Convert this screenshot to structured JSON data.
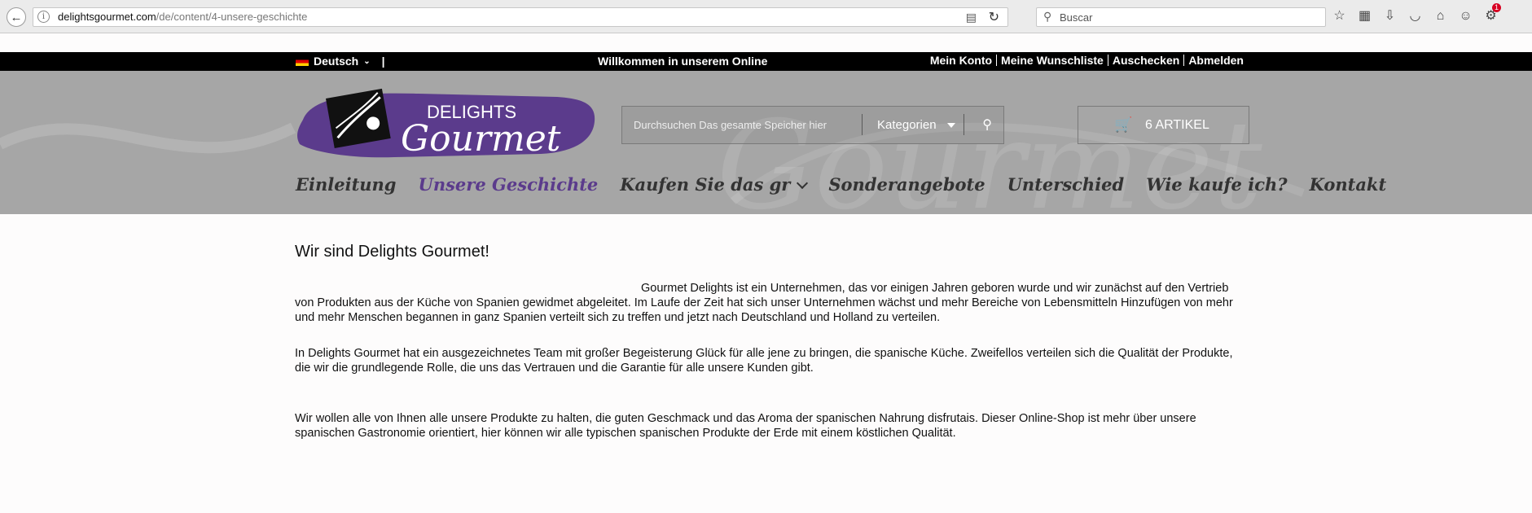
{
  "browser": {
    "url_domain": "delightsgourmet.com",
    "url_path": "/de/content/4-unsere-geschichte",
    "search_placeholder": "Buscar",
    "notification_badge": "1"
  },
  "topbar": {
    "language": "Deutsch",
    "welcome": "Willkommen in unserem Online",
    "links": [
      "Mein Konto",
      "Meine Wunschliste",
      "Auschecken",
      "Abmelden"
    ]
  },
  "header": {
    "logo_top": "DELIGHTS",
    "logo_main": "Gourmet",
    "search_placeholder": "Durchsuchen Das gesamte Speicher hier",
    "categories_label": "Kategorien",
    "cart_label": "6 ARTIKEL"
  },
  "nav": {
    "items": [
      "Einleitung",
      "Unsere Geschichte",
      "Kaufen Sie das gr",
      "Sonderangebote",
      "Unterschied",
      "Wie kaufe ich?",
      "Kontakt"
    ],
    "active_index": 1
  },
  "content": {
    "title": "Wir sind Delights Gourmet!",
    "p1": "Gourmet Delights ist ein Unternehmen, das vor einigen Jahren geboren wurde und wir zunächst auf den Vertrieb von Produkten aus der Küche von Spanien gewidmet abgeleitet. Im Laufe der Zeit hat sich unser Unternehmen wächst und mehr Bereiche von Lebensmitteln Hinzufügen von mehr und mehr Menschen begannen in ganz Spanien verteilt sich zu treffen und jetzt nach Deutschland und Holland zu verteilen.",
    "p2": "In Delights Gourmet hat ein ausgezeichnetes Team mit großer Begeisterung Glück für alle jene zu bringen, die spanische Küche. Zweifellos verteilen sich die Qualität der Produkte, die wir die grundlegende Rolle, die uns das Vertrauen und die Garantie für alle unsere Kunden gibt.",
    "p3": "Wir wollen alle von Ihnen alle unsere Produkte zu halten, die guten Geschmack und das Aroma der spanischen Nahrung disfrutais. Dieser Online-Shop ist mehr über unsere spanischen Gastronomie orientiert, hier können wir alle typischen spanischen Produkte der Erde mit einem köstlichen Qualität."
  },
  "colors": {
    "accent": "#5b3b8c",
    "header_bg": "#a6a6a6",
    "topbar_bg": "#000000"
  }
}
